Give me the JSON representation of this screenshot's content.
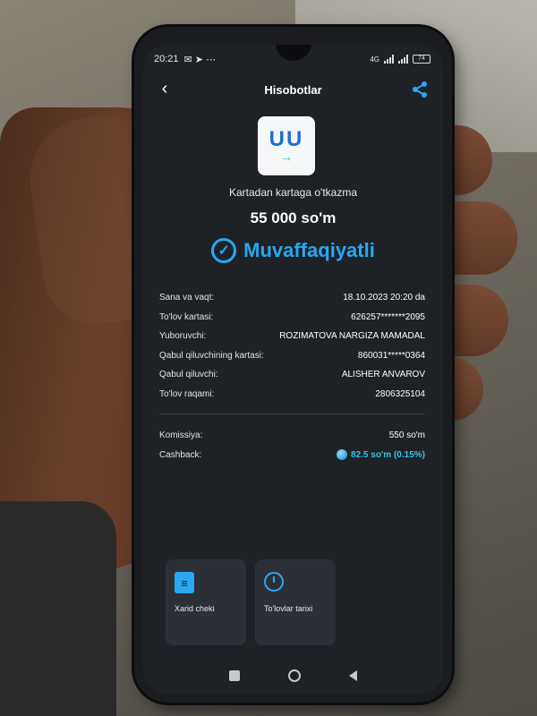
{
  "status_bar": {
    "time": "20:21",
    "network": "4G",
    "battery": "74"
  },
  "header": {
    "title": "Hisobotlar",
    "back_icon": "chevron-left-icon",
    "share_icon": "share-icon"
  },
  "logo": {
    "text": "UU",
    "arrow": "→"
  },
  "transaction": {
    "type": "Kartadan kartaga o'tkazma",
    "amount": "55 000 so'm",
    "status": "Muvaffaqiyatli",
    "status_icon": "check-circle-icon",
    "accent_color": "#2aa8ef"
  },
  "details": [
    {
      "label": "Sana va vaqt:",
      "value": "18.10.2023 20:20 da"
    },
    {
      "label": "To'lov kartasi:",
      "value": "626257*******2095"
    },
    {
      "label": "Yuboruvchi:",
      "value": "ROZIMATOVA NARGIZA MAMADAL"
    },
    {
      "label": "Qabul qiluvchining kartasi:",
      "value": "860031*****0364"
    },
    {
      "label": "Qabul qiluvchi:",
      "value": "ALISHER ANVAROV"
    },
    {
      "label": "To'lov raqami:",
      "value": "2806325104"
    }
  ],
  "fees": {
    "commission_label": "Komissiya:",
    "commission_value": "550 so'm",
    "cashback_label": "Cashback:",
    "cashback_value": "82.5 so'm (0.15%)"
  },
  "actions": [
    {
      "label": "Xarid cheki",
      "icon": "receipt-icon"
    },
    {
      "label": "To'lovlar tarixi",
      "icon": "history-icon"
    }
  ],
  "nav_bar": {
    "icons": [
      "recents-square-icon",
      "home-circle-icon",
      "back-triangle-icon"
    ]
  }
}
